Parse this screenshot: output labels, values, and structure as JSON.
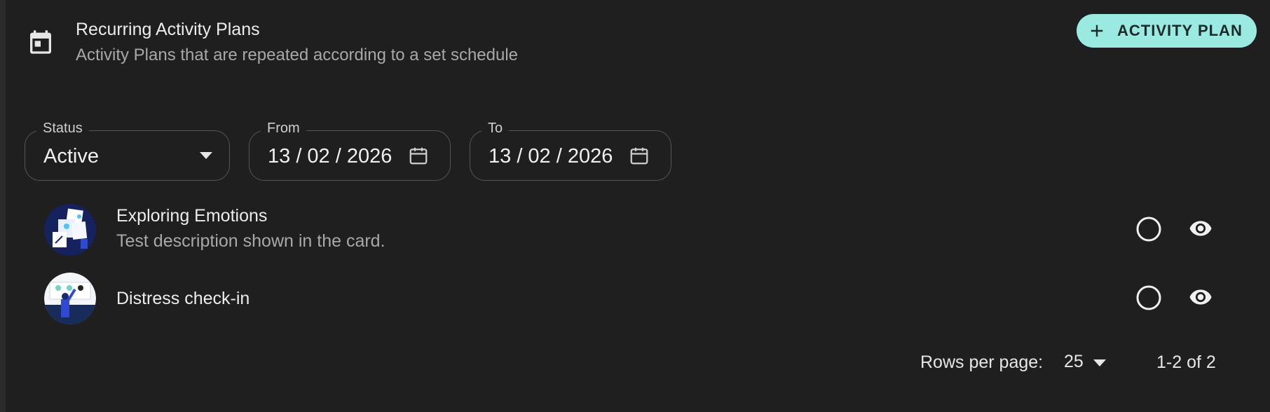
{
  "header": {
    "title": "Recurring Activity Plans",
    "subtitle": "Activity Plans that are repeated according to a set schedule",
    "add_button_label": "ACTIVITY PLAN"
  },
  "filters": {
    "status": {
      "label": "Status",
      "value": "Active"
    },
    "from": {
      "label": "From",
      "value": "13 / 02 / 2026"
    },
    "to": {
      "label": "To",
      "value": "13 / 02 / 2026"
    }
  },
  "plans": [
    {
      "title": "Exploring Emotions",
      "description": "Test description shown in the card."
    },
    {
      "title": "Distress check-in",
      "description": ""
    }
  ],
  "pagination": {
    "rows_per_page_label": "Rows per page:",
    "rows_per_page_value": "25",
    "range": "1-2 of 2"
  },
  "colors": {
    "background": "#1f1f1f",
    "accent_button": "#9beae1",
    "field_border": "#555555"
  },
  "icons": [
    "calendar-icon",
    "plus-icon",
    "dropdown-arrow-icon",
    "calendar-picker-icon",
    "radio-unchecked-icon",
    "eye-icon"
  ]
}
